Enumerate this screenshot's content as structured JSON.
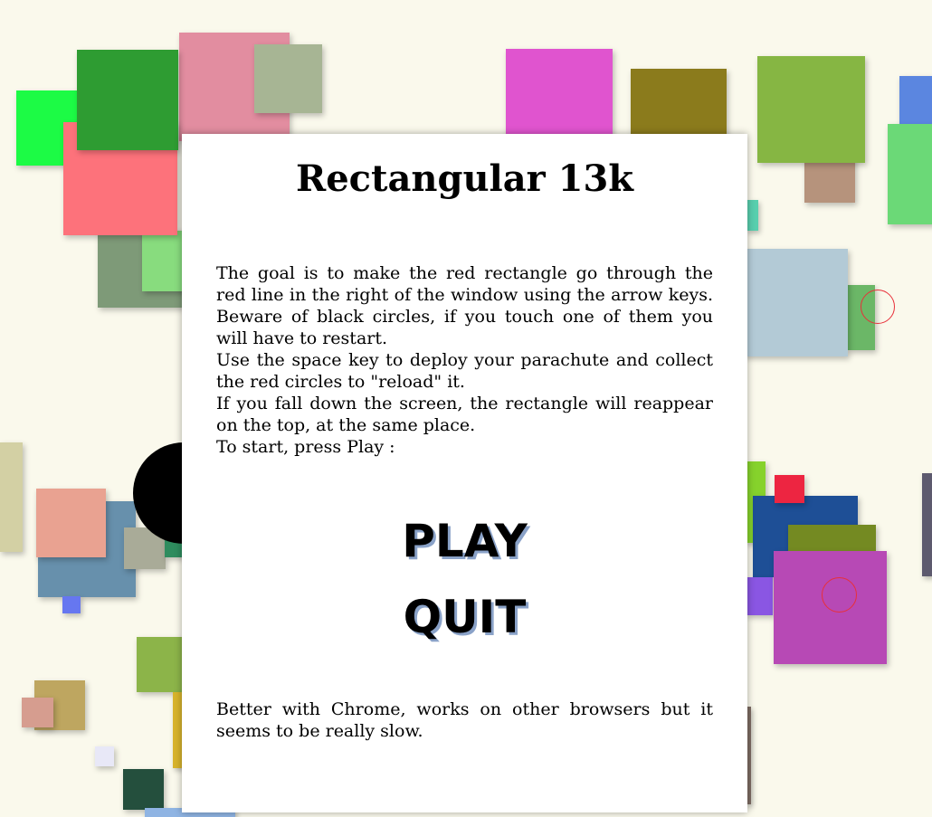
{
  "game": {
    "title": "Rectangular 13k",
    "instructions": [
      "The goal is to make the red rectangle go through the red line in the right of the window using the arrow keys. Beware of black circles, if you touch one of them you will have to restart.",
      "Use the space key to deploy your parachute and collect the red circles to \"reload\" it.",
      "If you fall down the screen, the rectangle will reappear on the top, at the same place.",
      "To start, press Play :"
    ],
    "menu": {
      "play_label": "PLAY",
      "quit_label": "QUIT"
    },
    "footer_note": "Better with Chrome, works on other browsers but it seems to be really slow."
  },
  "colors": {
    "background": "#faf9ec",
    "panel": "#ffffff",
    "button_shadow": "#8aa2c8",
    "pickup_ring": "#e8303a",
    "hazard": "#000000"
  }
}
